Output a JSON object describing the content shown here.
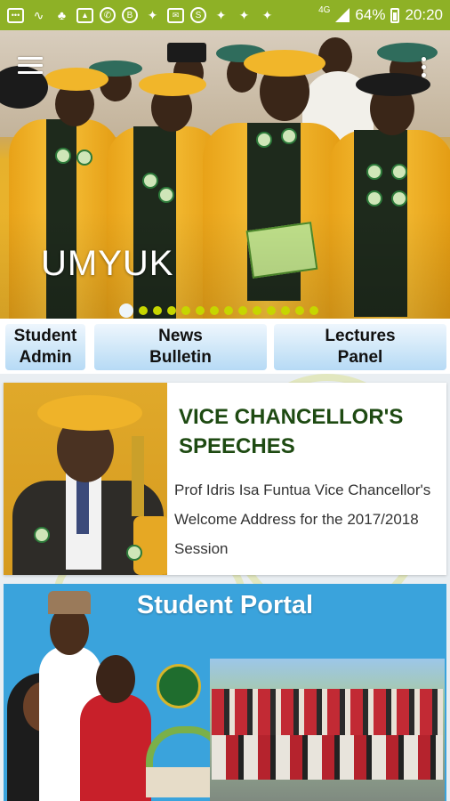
{
  "status_bar": {
    "network": "4G",
    "battery": "64%",
    "time": "20:20",
    "icons": [
      "message-icon",
      "trend-icon",
      "snapchat-icon",
      "image-icon",
      "whatsapp-icon",
      "bitcoin-icon",
      "twitter-icon",
      "mail-icon",
      "s-coin-icon",
      "twitter-icon",
      "twitter-icon",
      "twitter-icon"
    ]
  },
  "hero": {
    "title": "UMYUK",
    "slide_count": 14,
    "active_slide": 0
  },
  "nav": {
    "student_admin": {
      "line1": "Student",
      "line2": "Admin"
    },
    "news_bulletin": {
      "line1": "News",
      "line2": "Bulletin"
    },
    "lectures_panel": {
      "line1": "Lectures",
      "line2": "Panel"
    }
  },
  "vc_card": {
    "title": "VICE CHANCELLOR'S SPEECHES",
    "description": "Prof Idris Isa Funtua Vice Chancellor's Welcome Address for the 2017/2018 Session"
  },
  "portal": {
    "title": "Student Portal"
  },
  "colors": {
    "status_bar": "#8eb126",
    "nav_button": "#cfe7f8",
    "vc_title": "#1e4a12",
    "portal_bg": "#3aa3dc"
  }
}
